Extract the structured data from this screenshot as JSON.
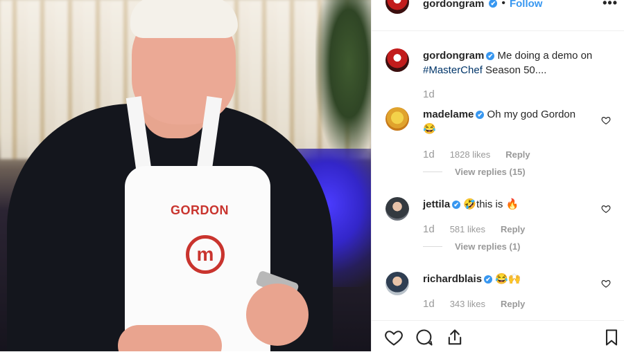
{
  "header": {
    "username": "gordongram",
    "verified": "✔",
    "follow_label": "Follow",
    "more_label": "•••"
  },
  "caption": {
    "username": "gordongram",
    "verified": "✔",
    "text_before": "Me doing a demo on",
    "hashtag": "#MasterChef",
    "text_after": "Season 50....",
    "age": "1d"
  },
  "photo": {
    "apron_name": "GORDON",
    "apron_logo": "m"
  },
  "comments": [
    {
      "username": "madelame",
      "verified": "✔",
      "text": "Oh my god Gordon",
      "emoji": "😂",
      "age": "1d",
      "likes": "1828 likes",
      "reply_label": "Reply",
      "view_replies": "View replies (15)",
      "avatar_icon": "user-avatar-icon"
    },
    {
      "username": "jettila",
      "verified": "✔",
      "text": "🤣this is 🔥",
      "age": "1d",
      "likes": "581 likes",
      "reply_label": "Reply",
      "view_replies": "View replies (1)",
      "avatar_icon": "user-avatar-icon"
    },
    {
      "username": "richardblais",
      "verified": "✔",
      "text": "😂🙌",
      "age": "1d",
      "likes": "343 likes",
      "reply_label": "Reply",
      "avatar_icon": "user-avatar-icon"
    }
  ],
  "actions": {
    "like_icon": "heart-icon",
    "comment_icon": "comment-icon",
    "share_icon": "share-icon",
    "save_icon": "bookmark-icon"
  },
  "colors": {
    "accent": "#3897f0",
    "hashtag": "#003569",
    "meta": "#999999"
  }
}
